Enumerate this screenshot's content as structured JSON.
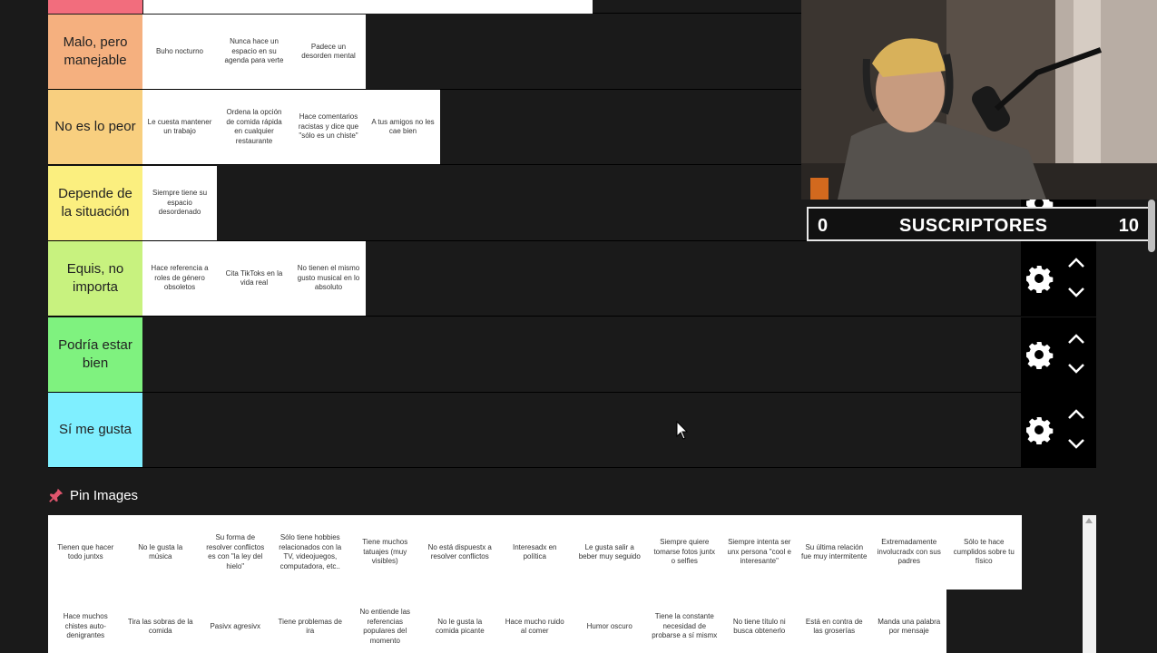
{
  "tiers": [
    {
      "label": "Malo, pero manejable",
      "color": "#f5b07f",
      "items": [
        "Buho nocturno",
        "Nunca hace un espacio en su agenda para verte",
        "Padece un desorden mental"
      ]
    },
    {
      "label": "No es lo peor",
      "color": "#f8cf7f",
      "items": [
        "Le cuesta mantener un trabajo",
        "Ordena la opción de comida rápida en cualquier restaurante",
        "Hace comentarios racistas y dice que \"sólo es un chiste\"",
        "A tus amigos no les cae bien"
      ]
    },
    {
      "label": "Depende de la situación",
      "color": "#fbef7f",
      "items": [
        "Siempre tiene su espacio desordenado"
      ]
    },
    {
      "label": "Equis, no importa",
      "color": "#c8f27f",
      "items": [
        "Hace referencia a roles de género obsoletos",
        "Cita TikToks en la vida real",
        "No tienen el mismo gusto musical en lo absoluto"
      ]
    },
    {
      "label": "Podría estar bien",
      "color": "#7ff27f",
      "items": []
    },
    {
      "label": "Sí me gusta",
      "color": "#7fefff",
      "items": []
    }
  ],
  "colors": {
    "top_tier": "#f26d7d"
  },
  "subscribers": {
    "left": "0",
    "label": "SUSCRIPTORES",
    "right": "10"
  },
  "pin_section": {
    "title": "Pin Images"
  },
  "pin_images": {
    "row1": [
      "Tienen que hacer todo juntxs",
      "No le gusta la música",
      "Su forma de resolver conflictos es con \"la ley del hielo\"",
      "Sólo tiene hobbies relacionados con la TV, videojuegos, computadora, etc..",
      "Tiene muchos tatuajes (muy visibles)",
      "No está dispuestx a resolver conflictos",
      "Interesadx en política",
      "Le gusta salir a beber muy seguido",
      "Siempre quiere tomarse fotos juntx o selfies",
      "Siempre intenta ser unx persona \"cool e interesante\"",
      "Su última relación fue muy intermitente",
      "Extremadamente involucradx con sus padres",
      "Sólo te hace cumplidos sobre tu físico"
    ],
    "row2": [
      "Hace muchos chistes auto-denigrantes",
      "Tira las sobras de la comida",
      "Pasivx agresivx",
      "Tiene problemas de ira",
      "No entiende las referencias populares del momento",
      "No le gusta la comida picante",
      "Hace mucho ruido al comer",
      "Humor oscuro",
      "Tiene la constante necesidad de probarse a sí mismx",
      "No tiene título ni busca obtenerlo",
      "Está en contra de las groserías",
      "Manda una palabra por mensaje"
    ]
  }
}
